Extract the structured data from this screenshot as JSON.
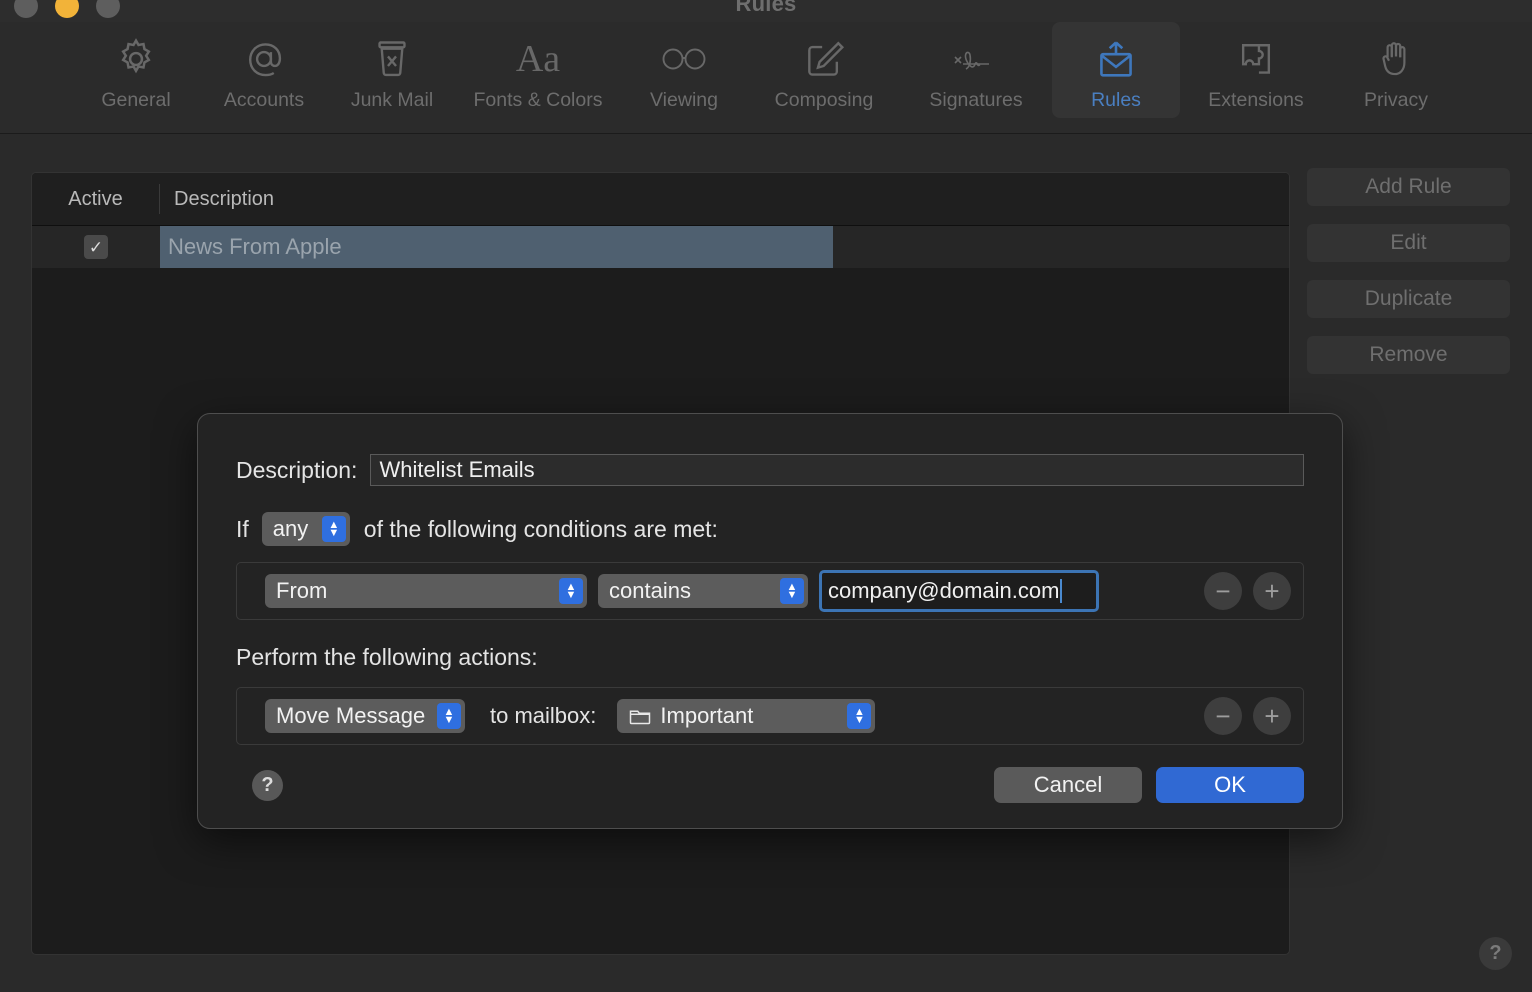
{
  "window": {
    "title": "Rules",
    "traffic_lights": [
      "close",
      "minimize",
      "zoom"
    ]
  },
  "toolbar": {
    "items": [
      {
        "label": "General",
        "icon": "gear-icon",
        "selected": false
      },
      {
        "label": "Accounts",
        "icon": "at-sign-icon",
        "selected": false
      },
      {
        "label": "Junk Mail",
        "icon": "junk-bin-icon",
        "selected": false
      },
      {
        "label": "Fonts & Colors",
        "icon": "aa-text-icon",
        "selected": false
      },
      {
        "label": "Viewing",
        "icon": "glasses-icon",
        "selected": false
      },
      {
        "label": "Composing",
        "icon": "compose-icon",
        "selected": false
      },
      {
        "label": "Signatures",
        "icon": "signature-icon",
        "selected": false
      },
      {
        "label": "Rules",
        "icon": "rules-mail-icon",
        "selected": true
      },
      {
        "label": "Extensions",
        "icon": "puzzle-icon",
        "selected": false
      },
      {
        "label": "Privacy",
        "icon": "hand-icon",
        "selected": false
      }
    ]
  },
  "rules_table": {
    "columns": {
      "active": "Active",
      "description": "Description"
    },
    "rows": [
      {
        "active": true,
        "checkmark": "✓",
        "description": "News From Apple",
        "selected": true
      }
    ]
  },
  "side_buttons": [
    {
      "label": "Add Rule",
      "name": "add-rule-button"
    },
    {
      "label": "Edit",
      "name": "edit-button"
    },
    {
      "label": "Duplicate",
      "name": "duplicate-button"
    },
    {
      "label": "Remove",
      "name": "remove-button"
    }
  ],
  "window_help": {
    "glyph": "?"
  },
  "sheet": {
    "description": {
      "label": "Description:",
      "value": "Whitelist Emails"
    },
    "conditions_header": {
      "prefix": "If",
      "match": "any",
      "suffix": "of the following conditions are met:"
    },
    "condition_rows": [
      {
        "field": "From",
        "operator": "contains",
        "value": "company@domain.com",
        "remove_glyph": "−",
        "add_glyph": "+"
      }
    ],
    "actions_header": "Perform the following actions:",
    "action_rows": [
      {
        "action": "Move Message",
        "to_label": "to mailbox:",
        "mailbox_icon": "folder-icon",
        "mailbox": "Important",
        "remove_glyph": "−",
        "add_glyph": "+"
      }
    ],
    "footer": {
      "help_glyph": "?",
      "cancel_label": "Cancel",
      "ok_label": "OK"
    }
  },
  "colors": {
    "accent_blue": "#3069d3",
    "stepper_blue": "#2f6fe0",
    "focus_ring": "#3c74b4",
    "selected_row": "#4f6070",
    "selected_tab_text": "#4a7fc1",
    "window_bg": "#2a2a2a",
    "sheet_bg": "#232323"
  }
}
